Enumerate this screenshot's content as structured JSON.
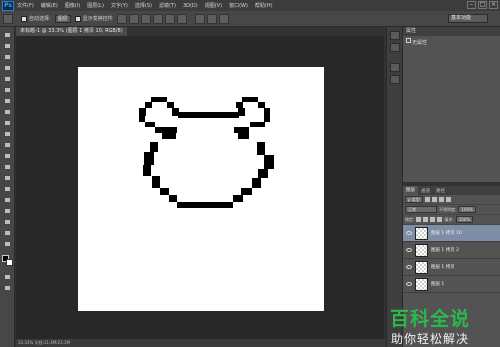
{
  "app": {
    "logo_text": "Ps",
    "menu": [
      "文件(F)",
      "编辑(E)",
      "图像(I)",
      "图层(L)",
      "文字(Y)",
      "选择(S)",
      "滤镜(T)",
      "3D(D)",
      "视图(V)",
      "窗口(W)",
      "帮助(H)"
    ]
  },
  "window_controls": [
    "–",
    "□",
    "×"
  ],
  "options_bar": {
    "auto_select_label": "自动选择:",
    "auto_select_value": "图层",
    "show_transform_label": "显示变换控件",
    "workspace": "基本功能"
  },
  "document": {
    "tab_label": "未标题-1 @ 33.3% (图层 1 拷贝 10, RGB/8)"
  },
  "status_bar": {
    "text": "33.33%   文档:11.4M/23.1M"
  },
  "properties_panel": {
    "tab": "属性",
    "title": "无属性"
  },
  "layers_panel": {
    "tabs": [
      "图层",
      "通道",
      "路径"
    ],
    "kind_filter": "ρ 类型",
    "blend_mode": "正常",
    "opacity_label": "不透明度:",
    "opacity_value": "100%",
    "lock_label": "锁定:",
    "fill_label": "填充:",
    "fill_value": "100%",
    "layers": [
      {
        "name": "图层 1 拷贝 10",
        "selected": true
      },
      {
        "name": "图层 1 拷贝 2",
        "selected": false
      },
      {
        "name": "图层 1 拷贝",
        "selected": false
      },
      {
        "name": "图层 1",
        "selected": false
      }
    ]
  },
  "watermark": {
    "top": "百科全说",
    "bottom": "助你轻松解决"
  },
  "colors": {
    "accent": "#2db84d",
    "selected_layer": "#7d8ea6",
    "canvas_bg": "#282828"
  }
}
